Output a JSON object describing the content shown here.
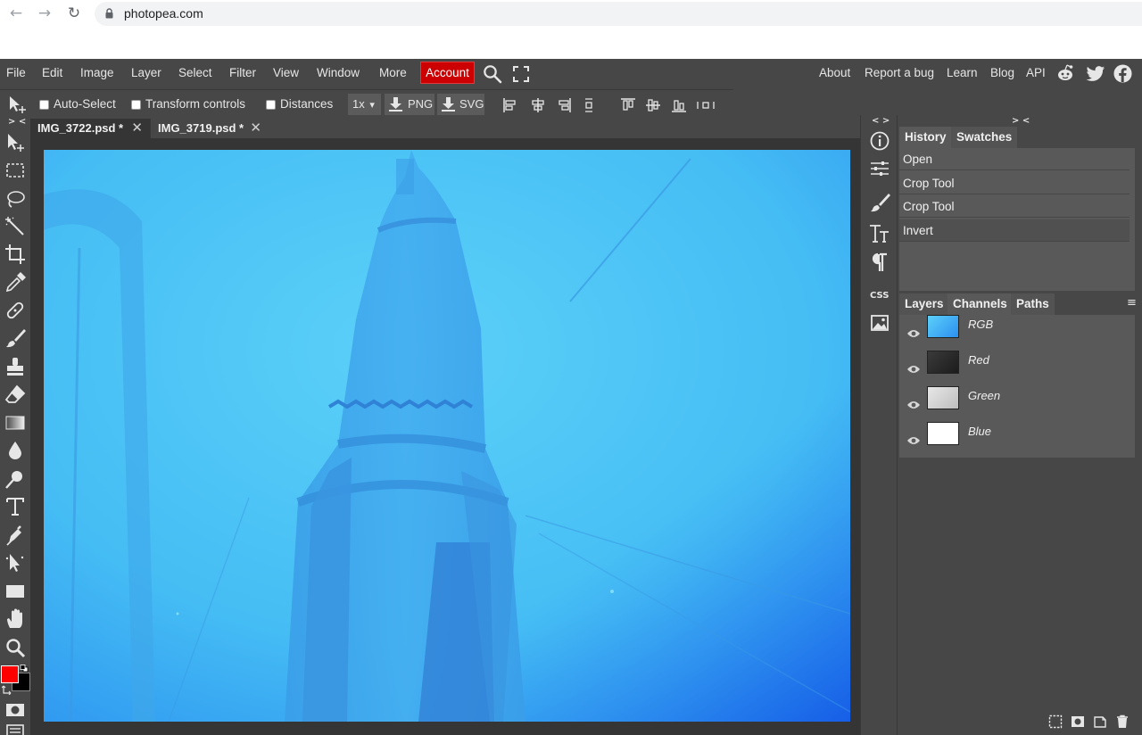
{
  "browser": {
    "back": "←",
    "forward": "→",
    "reload": "↻",
    "url": "photopea.com"
  },
  "menu": {
    "items": [
      "File",
      "Edit",
      "Image",
      "Layer",
      "Select",
      "Filter",
      "View",
      "Window",
      "More"
    ],
    "account": "Account",
    "right_links": [
      "About",
      "Report a bug",
      "Learn",
      "Blog",
      "API"
    ]
  },
  "options": {
    "auto_select": "Auto-Select",
    "transform_controls": "Transform controls",
    "distances": "Distances",
    "zoom": "1x",
    "zoom_arrow": "▾",
    "png": "PNG",
    "svg": "SVG"
  },
  "tabs": [
    {
      "label": "IMG_3722.psd *",
      "close": "✕"
    },
    {
      "label": "IMG_3719.psd *",
      "close": "✕"
    }
  ],
  "panels": {
    "left_collapse": "> <",
    "side_collapse": "< >",
    "right_collapse": "> <",
    "history_tabs": [
      "History",
      "Swatches"
    ],
    "history_items": [
      "Open",
      "Crop Tool",
      "Crop Tool",
      "Invert"
    ],
    "layer_tabs": [
      "Layers",
      "Channels",
      "Paths"
    ],
    "layer_menu": "≡",
    "channels": [
      {
        "name": "RGB",
        "thumb_color": "#3fb4f5"
      },
      {
        "name": "Red",
        "thumb_color": "#2a2a2a"
      },
      {
        "name": "Green",
        "thumb_color": "#d8d8d8"
      },
      {
        "name": "Blue",
        "thumb_color": "#ffffff"
      }
    ],
    "css_label": "CSS"
  },
  "colors": {
    "foreground": "#ff0000",
    "background": "#000000",
    "accent": "#cc0000",
    "canvas_main": "#4cc6f5",
    "canvas_edge": "#1f6ef0"
  }
}
